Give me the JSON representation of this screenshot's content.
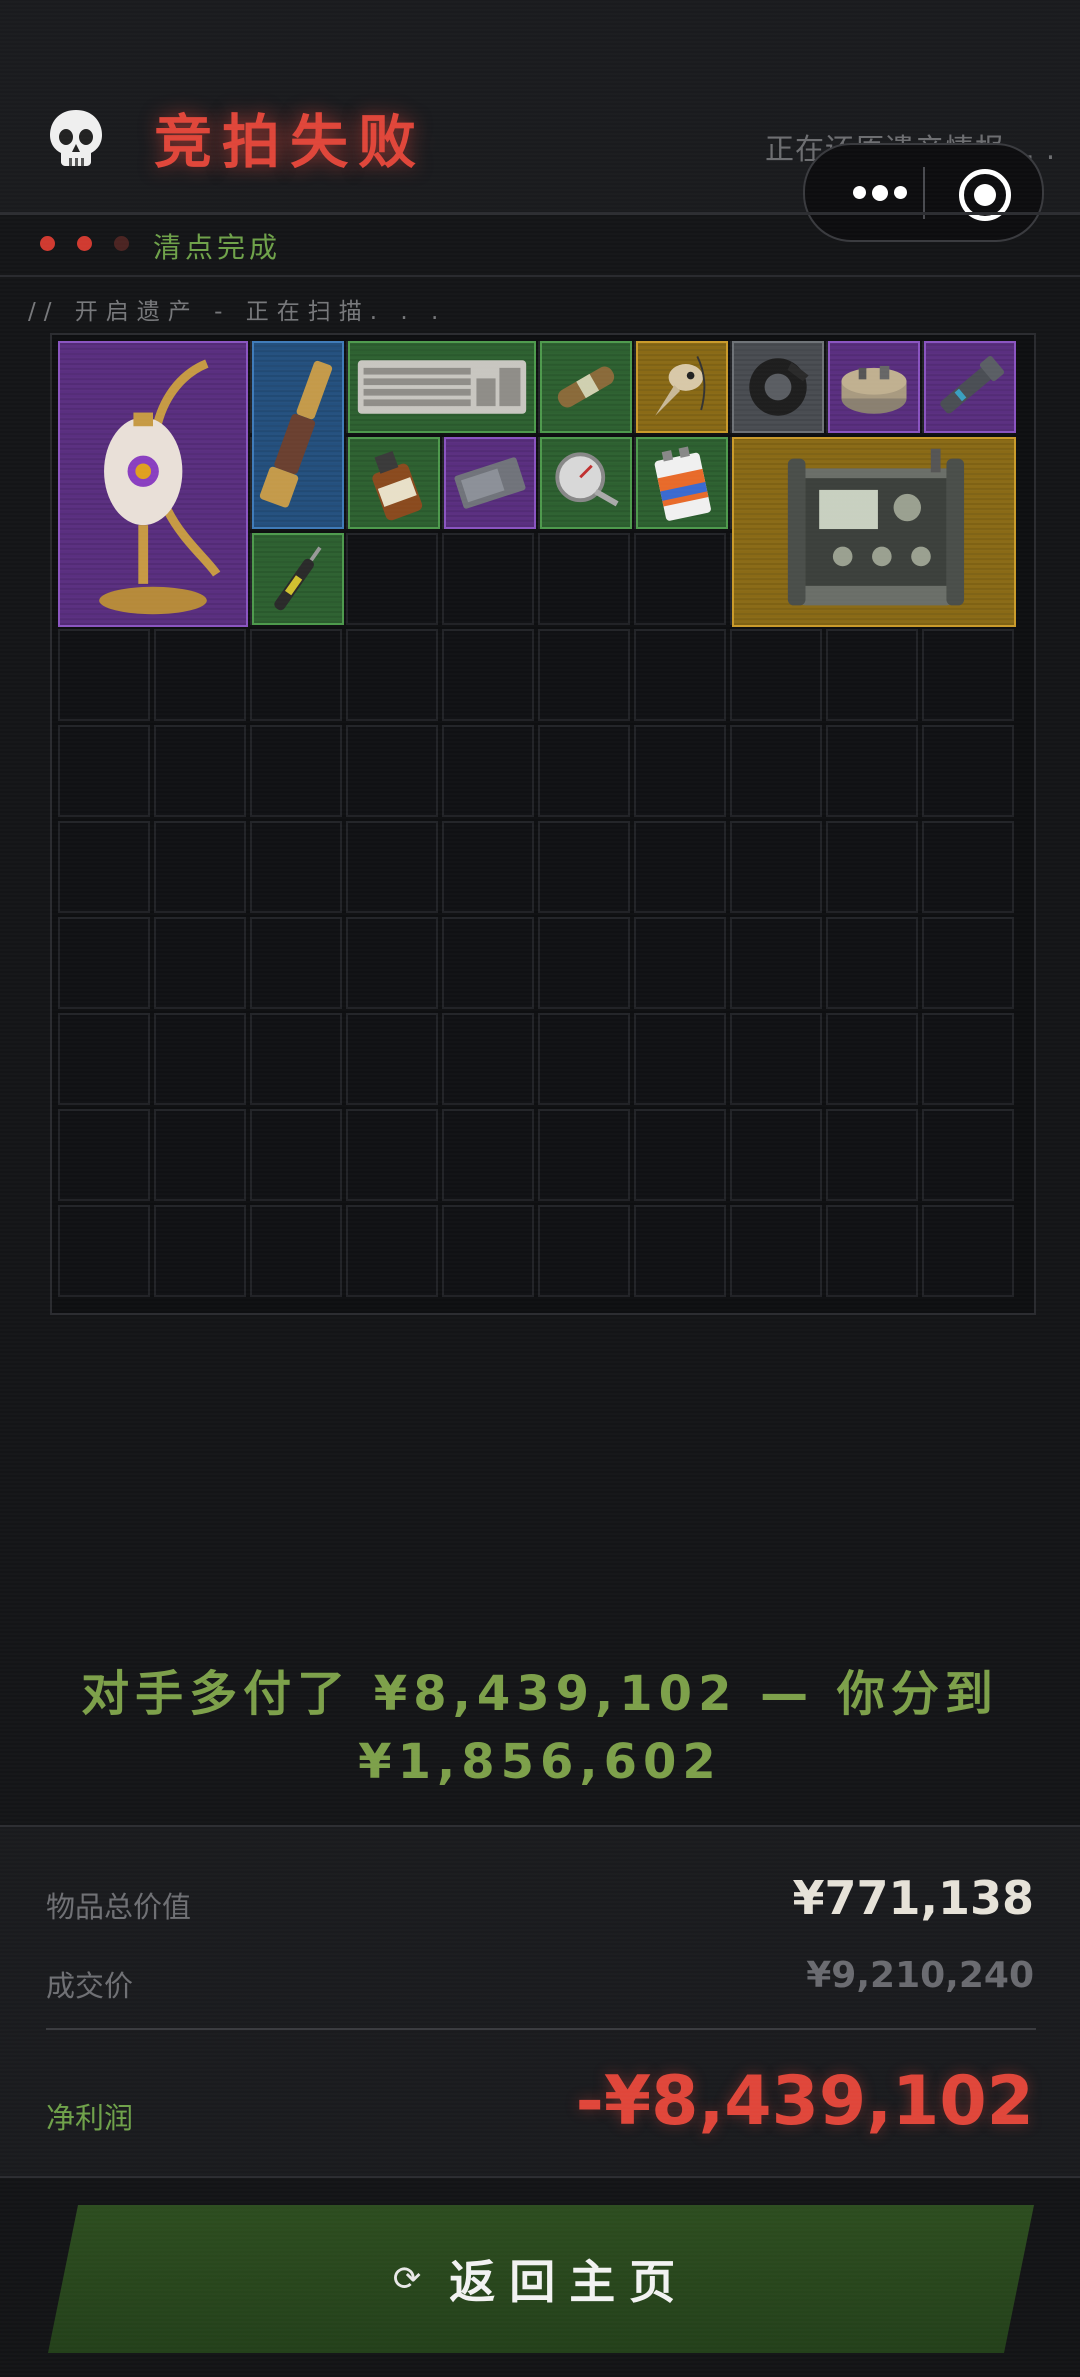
{
  "header": {
    "title": "竞拍失败",
    "restoring_text": "正在还原遗产情报. . .",
    "skull_icon": "skull-icon"
  },
  "status": {
    "text": "清点完成",
    "dots": [
      "active",
      "active",
      "inactive"
    ]
  },
  "scan_text": "//  开启遗产 - 正在扫描. . .",
  "inventory": {
    "columns": 10,
    "rows": 10,
    "items": [
      {
        "name": "crescent-moon-lamp",
        "rarity": "purple"
      },
      {
        "name": "brass-telescope",
        "rarity": "blue"
      },
      {
        "name": "keyboard",
        "rarity": "green"
      },
      {
        "name": "cigar",
        "rarity": "green"
      },
      {
        "name": "bird-skull-pendant",
        "rarity": "gold"
      },
      {
        "name": "duct-tape",
        "rarity": "grey"
      },
      {
        "name": "alarm-device",
        "rarity": "purple"
      },
      {
        "name": "flashlight",
        "rarity": "purple"
      },
      {
        "name": "medicine-bottle",
        "rarity": "green"
      },
      {
        "name": "hard-drive",
        "rarity": "purple"
      },
      {
        "name": "thermometer-gauge",
        "rarity": "green"
      },
      {
        "name": "battery",
        "rarity": "green"
      },
      {
        "name": "military-radio-station",
        "rarity": "gold"
      },
      {
        "name": "injector-pen",
        "rarity": "green"
      }
    ]
  },
  "summary": {
    "line1": "对手多付了 ¥8,439,102 — 你分到",
    "line2": "¥1,856,602"
  },
  "stats": {
    "total_value_label": "物品总价值",
    "total_value": "¥771,138",
    "deal_price_label": "成交价",
    "deal_price": "¥9,210,240",
    "net_profit_label": "净利润",
    "net_profit": "-¥8,439,102"
  },
  "home_button": {
    "label": "返回主页",
    "icon": "refresh-icon"
  },
  "colors": {
    "accent_red": "#e0463a",
    "accent_green": "#7da04a",
    "background": "#141517"
  }
}
